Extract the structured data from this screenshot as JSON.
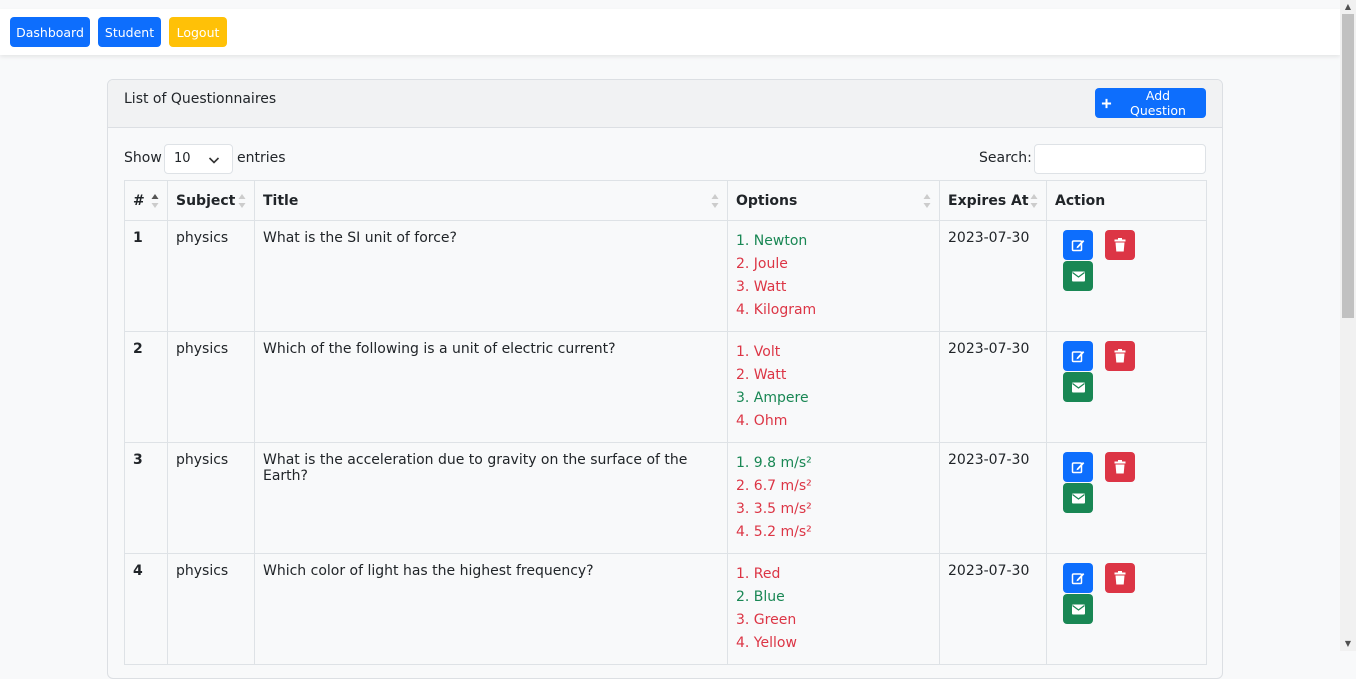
{
  "nav": {
    "dashboard": "Dashboard",
    "student": "Student",
    "logout": "Logout"
  },
  "card": {
    "title": "List of Questionnaires",
    "add_button": "Add Question"
  },
  "controls": {
    "show_label": "Show",
    "entries_value": "10",
    "entries_label": "entries",
    "search_label": "Search:",
    "search_value": ""
  },
  "table": {
    "headers": [
      "#",
      "Subject",
      "Title",
      "Options",
      "Expires At",
      "Action"
    ],
    "rows": [
      {
        "num": "1",
        "subject": "physics",
        "title": "What is the SI unit of force?",
        "options": [
          {
            "text": "1. Newton",
            "correct": true
          },
          {
            "text": "2. Joule",
            "correct": false
          },
          {
            "text": "3. Watt",
            "correct": false
          },
          {
            "text": "4. Kilogram",
            "correct": false
          }
        ],
        "expires": "2023-07-30"
      },
      {
        "num": "2",
        "subject": "physics",
        "title": "Which of the following is a unit of electric current?",
        "options": [
          {
            "text": "1. Volt",
            "correct": false
          },
          {
            "text": "2. Watt",
            "correct": false
          },
          {
            "text": "3. Ampere",
            "correct": true
          },
          {
            "text": "4. Ohm",
            "correct": false
          }
        ],
        "expires": "2023-07-30"
      },
      {
        "num": "3",
        "subject": "physics",
        "title": "What is the acceleration due to gravity on the surface of the Earth?",
        "options": [
          {
            "text": "1. 9.8 m/s²",
            "correct": true
          },
          {
            "text": "2. 6.7 m/s²",
            "correct": false
          },
          {
            "text": "3. 3.5 m/s²",
            "correct": false
          },
          {
            "text": "4. 5.2 m/s²",
            "correct": false
          }
        ],
        "expires": "2023-07-30"
      },
      {
        "num": "4",
        "subject": "physics",
        "title": "Which color of light has the highest frequency?",
        "options": [
          {
            "text": "1. Red",
            "correct": false
          },
          {
            "text": "2. Blue",
            "correct": true
          },
          {
            "text": "3. Green",
            "correct": false
          },
          {
            "text": "4. Yellow",
            "correct": false
          }
        ],
        "expires": "2023-07-30"
      }
    ]
  },
  "colors": {
    "primary": "#0d6efd",
    "warning": "#ffc107",
    "danger": "#dc3545",
    "success": "#198754"
  },
  "icons": {
    "edit": "edit-icon",
    "delete": "trash-icon",
    "mail": "envelope-icon",
    "add": "plus-icon"
  }
}
